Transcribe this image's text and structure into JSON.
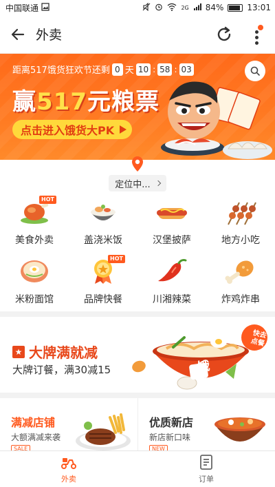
{
  "status_bar": {
    "carrier": "中国联通",
    "network": "2G",
    "battery": "84%",
    "time": "13:01"
  },
  "app_bar": {
    "title": "外卖"
  },
  "banner": {
    "countdown_prefix": "距离517饿货狂欢节还剩",
    "days": "0",
    "day_unit": "天",
    "hours": "10",
    "minutes": "58",
    "seconds": "03",
    "headline_pre": "赢",
    "headline_num": "517",
    "headline_post": "元粮票",
    "cta": "点击进入饿货大PK"
  },
  "location": {
    "label": "定位中..."
  },
  "categories": [
    {
      "label": "美食外卖",
      "icon": "roast-chicken-icon",
      "hot": "HOT"
    },
    {
      "label": "盖浇米饭",
      "icon": "rice-bowl-icon"
    },
    {
      "label": "汉堡披萨",
      "icon": "hotdog-icon"
    },
    {
      "label": "地方小吃",
      "icon": "skewers-icon"
    },
    {
      "label": "米粉面馆",
      "icon": "noodle-bowl-icon"
    },
    {
      "label": "品牌快餐",
      "icon": "medal-icon",
      "hot": "HOT"
    },
    {
      "label": "川湘辣菜",
      "icon": "chili-pepper-icon"
    },
    {
      "label": "炸鸡炸串",
      "icon": "fried-drumstick-icon"
    }
  ],
  "promo": {
    "title": "大牌满就减",
    "subtitle": "大牌订餐，满30减15",
    "bowl_char": "饿",
    "sticker": "快去点餐"
  },
  "cards": [
    {
      "title": "满减店铺",
      "subtitle": "大额满减来袭",
      "tag": "SALE",
      "title_color": "#ff5a1f"
    },
    {
      "title": "优质新店",
      "subtitle": "新店新口味",
      "tag": "NEW",
      "title_color": "#333333"
    }
  ],
  "bottom_nav": [
    {
      "label": "外卖",
      "icon": "scooter-icon",
      "active": true
    },
    {
      "label": "订单",
      "icon": "order-list-icon",
      "active": false
    }
  ],
  "colors": {
    "accent": "#ff5a1f",
    "banner": "#ff6a1a",
    "promo_red": "#e8481b"
  }
}
